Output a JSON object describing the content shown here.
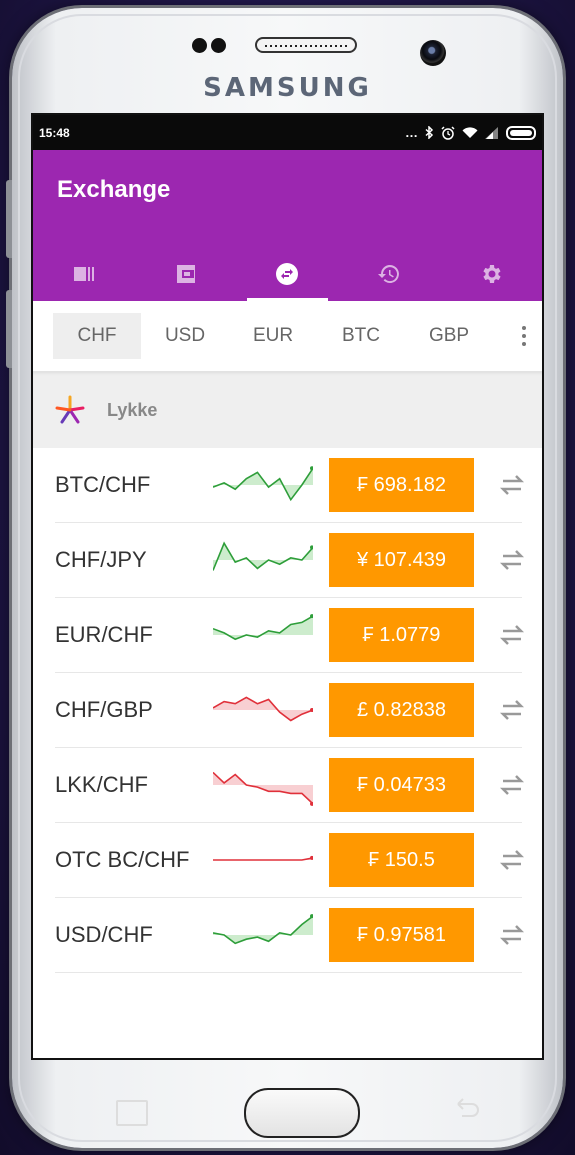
{
  "device": {
    "brand": "SAMSUNG"
  },
  "status_bar": {
    "time": "15:48",
    "icons": [
      "more-dots-icon",
      "bluetooth-icon",
      "alarm-icon",
      "wifi-icon",
      "signal-icon",
      "battery-icon"
    ]
  },
  "app_bar": {
    "title": "Exchange",
    "color": "#9c27b0",
    "tabs": [
      {
        "icon": "card-icon",
        "active": false
      },
      {
        "icon": "wallet-icon",
        "active": false
      },
      {
        "icon": "exchange-icon",
        "active": true
      },
      {
        "icon": "history-icon",
        "active": false
      },
      {
        "icon": "settings-icon",
        "active": false
      }
    ]
  },
  "currency_tabs": {
    "items": [
      "CHF",
      "USD",
      "EUR",
      "BTC",
      "GBP"
    ],
    "selected": "CHF"
  },
  "source": {
    "name": "Lykke"
  },
  "rates": [
    {
      "pair": "BTC/CHF",
      "price": "₣ 698.182",
      "trend": "up",
      "spark": [
        0.55,
        0.45,
        0.6,
        0.35,
        0.2,
        0.55,
        0.35,
        0.85,
        0.5,
        0.1
      ]
    },
    {
      "pair": "CHF/JPY",
      "price": "¥ 107.439",
      "trend": "up",
      "spark": [
        0.75,
        0.1,
        0.55,
        0.45,
        0.7,
        0.5,
        0.6,
        0.45,
        0.5,
        0.2
      ]
    },
    {
      "pair": "EUR/CHF",
      "price": "₣ 1.0779",
      "trend": "up",
      "spark": [
        0.35,
        0.45,
        0.6,
        0.5,
        0.55,
        0.4,
        0.45,
        0.25,
        0.2,
        0.05
      ]
    },
    {
      "pair": "CHF/GBP",
      "price": "£ 0.82838",
      "trend": "down",
      "spark": [
        0.45,
        0.3,
        0.35,
        0.2,
        0.35,
        0.25,
        0.55,
        0.75,
        0.6,
        0.5
      ]
    },
    {
      "pair": "LKK/CHF",
      "price": "₣ 0.04733",
      "trend": "down",
      "spark": [
        0.2,
        0.45,
        0.25,
        0.5,
        0.55,
        0.65,
        0.65,
        0.7,
        0.7,
        0.95
      ]
    },
    {
      "pair": "OTC BC/CHF",
      "price": "₣ 150.5",
      "trend": "down",
      "spark": [
        0.5,
        0.5,
        0.5,
        0.5,
        0.5,
        0.5,
        0.5,
        0.5,
        0.5,
        0.45
      ]
    },
    {
      "pair": "USD/CHF",
      "price": "₣ 0.97581",
      "trend": "up",
      "spark": [
        0.45,
        0.5,
        0.7,
        0.6,
        0.55,
        0.65,
        0.45,
        0.5,
        0.25,
        0.05
      ]
    }
  ],
  "colors": {
    "price_button": "#ff9800",
    "trend_up_line": "#2e9e3a",
    "trend_up_fill": "#cdeccd",
    "trend_down_line": "#e0303a",
    "trend_down_fill": "#f8cfd2"
  }
}
